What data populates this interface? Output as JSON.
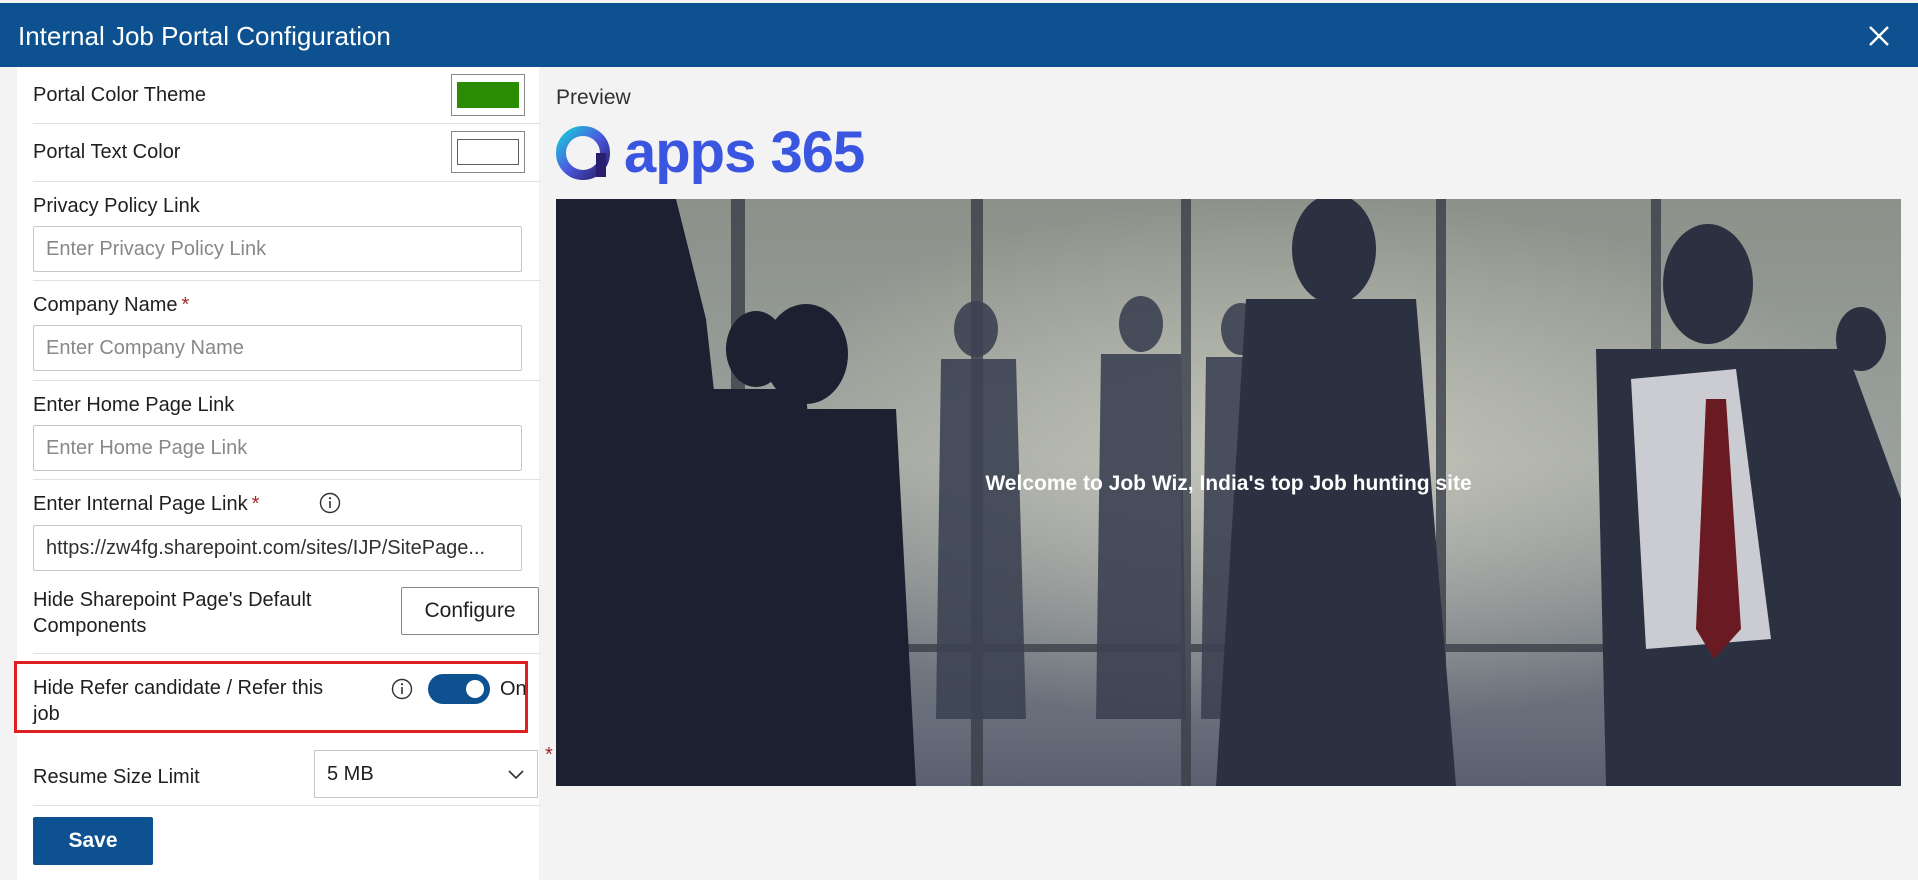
{
  "window": {
    "title": "Internal Job Portal Configuration"
  },
  "form": {
    "portal_color_theme": {
      "label": "Portal Color Theme",
      "color": "#2a8c00"
    },
    "portal_text_color": {
      "label": "Portal Text Color",
      "color": "#ffffff"
    },
    "privacy_policy": {
      "label": "Privacy Policy Link",
      "placeholder": "Enter Privacy Policy Link",
      "value": ""
    },
    "company_name": {
      "label": "Company Name",
      "required_mark": "*",
      "placeholder": "Enter Company Name",
      "value": ""
    },
    "home_page": {
      "label": "Enter Home Page Link",
      "placeholder": "Enter Home Page Link",
      "value": ""
    },
    "internal_page": {
      "label": "Enter Internal Page Link",
      "required_mark": "*",
      "value": "https://zw4fg.sharepoint.com/sites/IJP/SitePage..."
    },
    "hide_sharepoint": {
      "label": "Hide Sharepoint Page's Default Components",
      "button": "Configure"
    },
    "hide_refer": {
      "label": "Hide Refer candidate / Refer this job",
      "state_label": "On",
      "on": true
    },
    "resume_size": {
      "label": "Resume Size Limit",
      "value": "5 MB",
      "required_mark": "*"
    },
    "save_label": "Save"
  },
  "preview": {
    "label": "Preview",
    "logo_text": "apps 365",
    "banner_text": "Welcome to Job Wiz, India's top Job hunting site"
  },
  "colors": {
    "header": "#0e5190",
    "accent": "#0e5190",
    "highlight": "#e02020"
  }
}
